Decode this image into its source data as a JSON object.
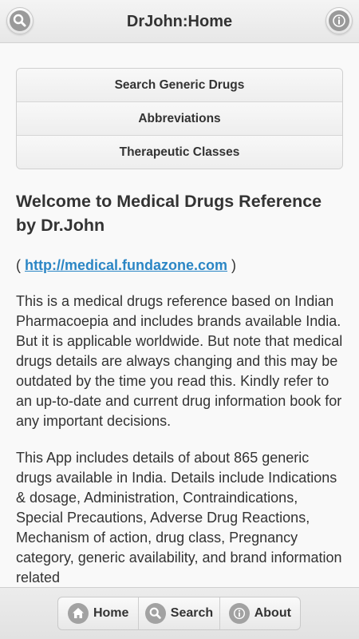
{
  "header": {
    "title": "DrJohn:Home",
    "left_icon": "search-icon",
    "right_icon": "info-icon"
  },
  "menu": {
    "items": [
      {
        "label": "Search Generic Drugs"
      },
      {
        "label": "Abbreviations"
      },
      {
        "label": "Therapeutic Classes"
      }
    ]
  },
  "main": {
    "welcome_title": "Welcome to Medical Drugs Reference by Dr.John",
    "link_open": "(",
    "link_text": "http://medical.fundazone.com",
    "link_close": ")",
    "paragraph1": "This is a medical drugs reference based on Indian Pharmacoepia and includes brands available India. But it is applicable worldwide. But note that medical drugs details are always changing and this may be outdated by the time you read this. Kindly refer to an up-to-date and current drug information book for any important decisions.",
    "paragraph2": "This App includes details of about 865 generic drugs available in India. Details include Indications & dosage, Administration, Contraindications, Special Precautions, Adverse Drug Reactions, Mechanism of action, drug class, Pregnancy category, generic availability, and brand information related"
  },
  "footer": {
    "nav": [
      {
        "label": "Home",
        "icon": "home-icon"
      },
      {
        "label": "Search",
        "icon": "search-icon"
      },
      {
        "label": "About",
        "icon": "info-icon"
      }
    ]
  },
  "colors": {
    "link": "#2b86c5",
    "icon_gray": "#9a9a9a"
  }
}
